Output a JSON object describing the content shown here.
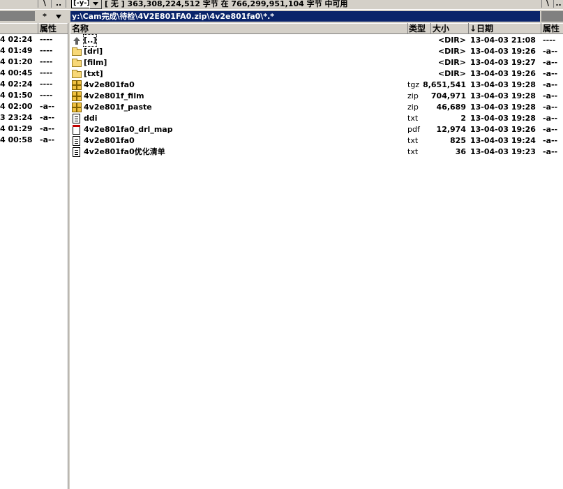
{
  "top": {
    "left_btn_backslash": "\\",
    "left_btn_dotdot": "..",
    "drive_selected": "[-y-]",
    "free_space_text": "[ 无 ]  363,308,224,512 字节 在 766,299,951,104 字节 中可用",
    "right_btn_backslash": "\\",
    "right_btn_dotdot": ".."
  },
  "paths": {
    "left_star": "*",
    "right_star": "*",
    "right_path": "y:\\Cam完成\\待检\\4V2E801FA0.zip\\4v2e801fa0\\*.*"
  },
  "left_panel": {
    "header_attr": "属性",
    "rows": [
      {
        "time": "4 02:24",
        "attr": "----"
      },
      {
        "time": "4 01:49",
        "attr": "----"
      },
      {
        "time": "4 01:20",
        "attr": "----"
      },
      {
        "time": "4 00:45",
        "attr": "----"
      },
      {
        "time": "4 02:24",
        "attr": "----"
      },
      {
        "time": "4 01:50",
        "attr": "----"
      },
      {
        "time": "4 02:00",
        "attr": "-a--"
      },
      {
        "time": "3 23:24",
        "attr": "-a--"
      },
      {
        "time": "4 01:29",
        "attr": "-a--"
      },
      {
        "time": "4 00:58",
        "attr": "-a--"
      }
    ]
  },
  "right_panel": {
    "headers": {
      "name": "名称",
      "type": "类型",
      "size": "大小",
      "date": "↓日期",
      "attr": "属性"
    },
    "files": [
      {
        "icon": "up-dir-icon",
        "name": "[..]",
        "ext": "",
        "size": "<DIR>",
        "date": "13-04-03 21:08",
        "attr": "----"
      },
      {
        "icon": "folder-icon",
        "name": "[drl]",
        "ext": "",
        "size": "<DIR>",
        "date": "13-04-03 19:26",
        "attr": "-a--"
      },
      {
        "icon": "folder-icon",
        "name": "[film]",
        "ext": "",
        "size": "<DIR>",
        "date": "13-04-03 19:27",
        "attr": "-a--"
      },
      {
        "icon": "folder-icon",
        "name": "[txt]",
        "ext": "",
        "size": "<DIR>",
        "date": "13-04-03 19:26",
        "attr": "-a--"
      },
      {
        "icon": "archive-icon",
        "name": "4v2e801fa0",
        "ext": "tgz",
        "size": "8,651,541",
        "date": "13-04-03 19:28",
        "attr": "-a--"
      },
      {
        "icon": "archive-icon",
        "name": "4v2e801f_film",
        "ext": "zip",
        "size": "704,971",
        "date": "13-04-03 19:28",
        "attr": "-a--"
      },
      {
        "icon": "archive-icon",
        "name": "4v2e801f_paste",
        "ext": "zip",
        "size": "46,689",
        "date": "13-04-03 19:28",
        "attr": "-a--"
      },
      {
        "icon": "text-file-icon",
        "name": "ddi",
        "ext": "txt",
        "size": "2",
        "date": "13-04-03 19:28",
        "attr": "-a--"
      },
      {
        "icon": "pdf-file-icon",
        "name": "4v2e801fa0_drl_map",
        "ext": "pdf",
        "size": "12,974",
        "date": "13-04-03 19:26",
        "attr": "-a--"
      },
      {
        "icon": "text-file-icon",
        "name": "4v2e801fa0",
        "ext": "txt",
        "size": "825",
        "date": "13-04-03 19:24",
        "attr": "-a--"
      },
      {
        "icon": "text-file-icon",
        "name": "4v2e801fa0优化清单",
        "ext": "txt",
        "size": "36",
        "date": "13-04-03 19:23",
        "attr": "-a--"
      }
    ]
  }
}
